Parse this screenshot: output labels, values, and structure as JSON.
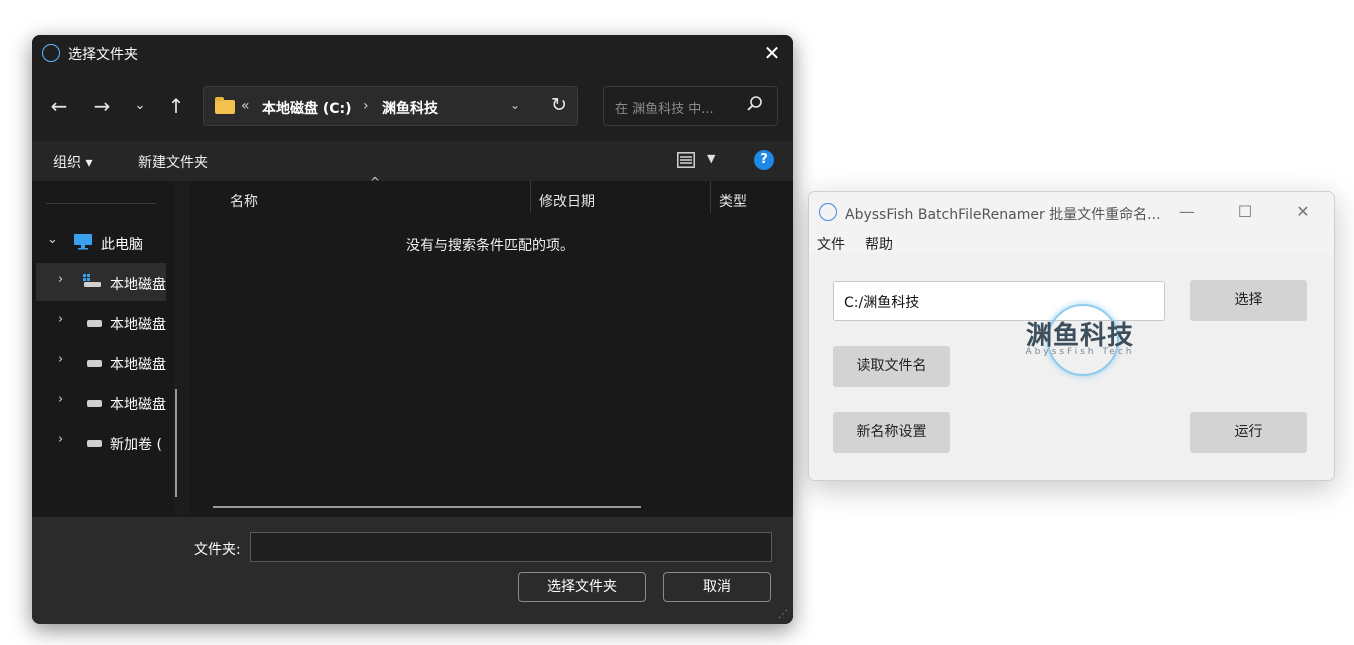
{
  "folder_dialog": {
    "title": "选择文件夹",
    "nav": {
      "back_icon": "arrow-left",
      "forward_icon": "arrow-right",
      "recent_icon": "chevron-down",
      "up_icon": "arrow-up"
    },
    "address": {
      "overflow": "«",
      "crumbs": [
        "本地磁盘 (C:)",
        "渊鱼科技"
      ],
      "separator": "›"
    },
    "search_placeholder": "在 渊鱼科技 中...",
    "commands": {
      "organize": "组织 ▾",
      "new_folder": "新建文件夹"
    },
    "nav_pane": {
      "items": [
        {
          "label": "此电脑",
          "expanded": true
        },
        {
          "label": "本地磁盘"
        },
        {
          "label": "本地磁盘"
        },
        {
          "label": "本地磁盘"
        },
        {
          "label": "本地磁盘"
        },
        {
          "label": "新加卷 ("
        }
      ]
    },
    "columns": [
      "名称",
      "修改日期",
      "类型"
    ],
    "empty_message": "没有与搜索条件匹配的项。",
    "folder_label": "文件夹:",
    "folder_value": "",
    "select_button": "选择文件夹",
    "cancel_button": "取消",
    "colors": {
      "accent": "#1e88e5",
      "background": "#1c1c1c"
    }
  },
  "renamer": {
    "title": "AbyssFish BatchFileRenamer 批量文件重命名...",
    "menu": [
      "文件",
      "帮助"
    ],
    "path_value": "C:/渊鱼科技",
    "select_button": "选择",
    "read_names_button": "读取文件名",
    "new_name_button": "新名称设置",
    "run_button": "运行",
    "logo": {
      "name": "渊鱼科技",
      "sub": "AbyssFish Tech"
    }
  }
}
